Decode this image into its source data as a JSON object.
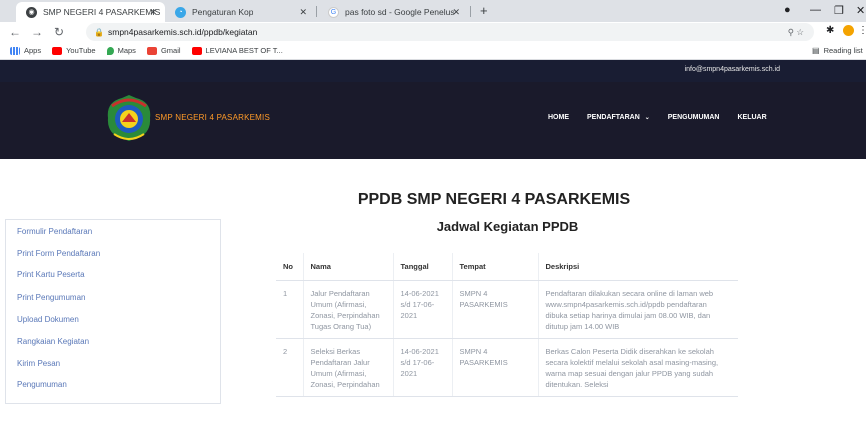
{
  "browser": {
    "tabs": [
      {
        "title": "SMP NEGERI 4 PASARKEMIS",
        "active": true
      },
      {
        "title": "Pengaturan Kop",
        "active": false
      },
      {
        "title": "pas foto sd - Google Penelusuran",
        "active": false
      }
    ],
    "new_tab": "+",
    "url": "smpn4pasarkemis.sch.id/ppdb/kegiatan",
    "bookmarks": [
      "Apps",
      "YouTube",
      "Maps",
      "Gmail",
      "LEVIANA BEST OF T..."
    ],
    "reading_list": "Reading list",
    "colors": {
      "tabstrip": "#dee1e6",
      "youtube": "#ff0000",
      "profile": "#f4a300"
    }
  },
  "site": {
    "email": "info@smpn4pasarkemis.sch.id",
    "brand": "SMP NEGERI 4 PASARKEMIS",
    "nav": [
      "HOME",
      "PENDAFTARAN",
      "PENGUMUMAN",
      "KELUAR"
    ],
    "page_title": "PPDB SMP NEGERI 4 PASARKEMIS",
    "colors": {
      "topbar": "#191d33",
      "header": "#1a1a2b",
      "brand": "#ff9a28",
      "sidebar_link": "#5a78b8"
    }
  },
  "sidebar": {
    "items": [
      "Formulir Pendaftaran",
      "Print Form Pendaftaran",
      "Print Kartu Peserta",
      "Print Pengumuman",
      "Upload Dokumen",
      "Rangkaian Kegiatan",
      "Kirim Pesan",
      "Pengumuman"
    ]
  },
  "schedule": {
    "title": "Jadwal Kegiatan PPDB",
    "headers": [
      "No",
      "Nama",
      "Tanggal",
      "Tempat",
      "Deskripsi"
    ],
    "rows": [
      {
        "no": "1",
        "nama": "Jalur Pendaftaran Umum (Afirmasi, Zonasi, Perpindahan Tugas Orang Tua)",
        "tanggal": "14-06-2021 s/d 17-06-2021",
        "tempat": "SMPN 4 PASARKEMIS",
        "deskripsi": "Pendaftaran dilakukan secara online di laman web www.smpn4pasarkemis.sch.id/ppdb pendaftaran dibuka setiap harinya dimulai jam 08.00 WIB, dan ditutup jam 14.00 WIB"
      },
      {
        "no": "2",
        "nama": "Seleksi Berkas Pendaftaran Jalur Umum (Afirmasi, Zonasi, Perpindahan",
        "tanggal": "14-06-2021 s/d 17-06-2021",
        "tempat": "SMPN 4 PASARKEMIS",
        "deskripsi": "Berkas Calon Peserta Didik diserahkan ke sekolah secara kolektif melalui sekolah asal masing-masing, warna map sesuai dengan jalur PPDB yang sudah ditentukan. Seleksi"
      }
    ]
  }
}
